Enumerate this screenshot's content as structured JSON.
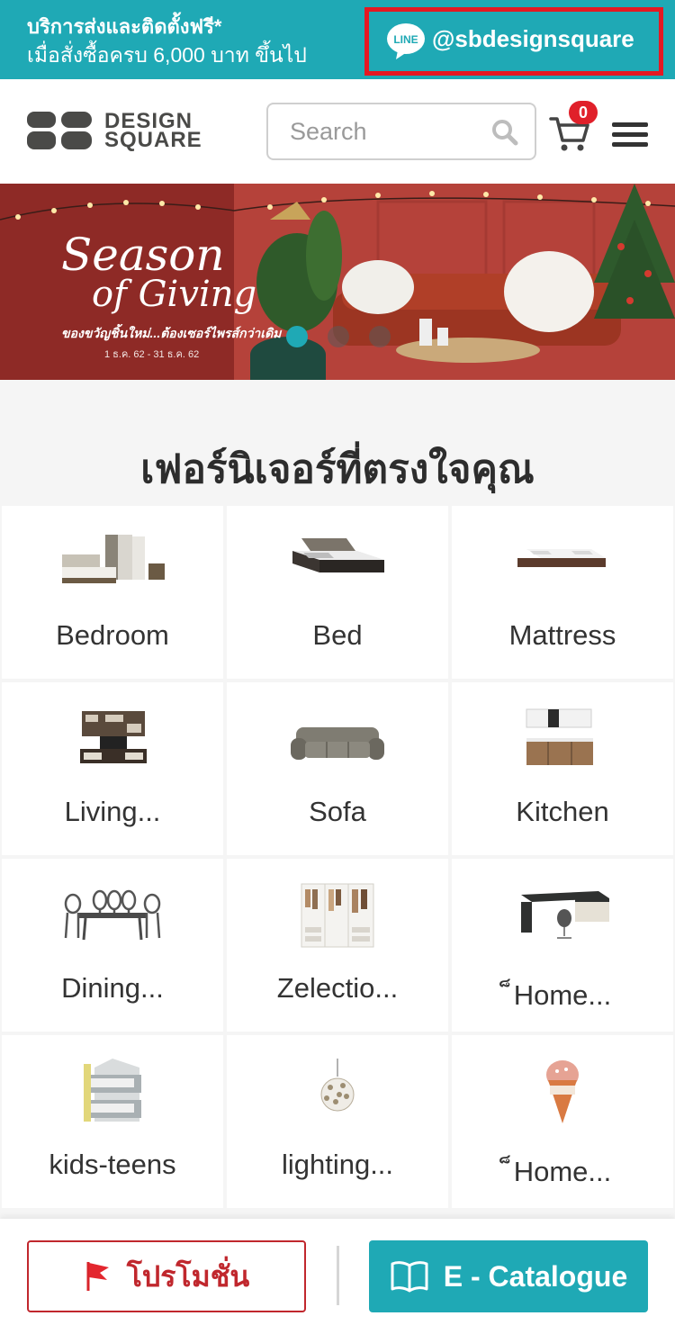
{
  "promo_bar": {
    "line1": "บริการส่งและติดตั้งฟรี*",
    "line2": "เมื่อสั่งซื้อครบ 6,000 บาท ขึ้นไป",
    "line_logo_text": "LINE",
    "line_handle": "@sbdesignsquare"
  },
  "header": {
    "brand_line1": "DESIGN",
    "brand_line2": "SQUARE",
    "search_placeholder": "Search",
    "cart_count": "0"
  },
  "banner": {
    "title_line1": "Season",
    "title_line2": "of Giving",
    "subtitle": "ของขวัญชิ้นใหม่...ต้องเซอร์ไพรส์กว่าเดิม",
    "date_range": "1 ธ.ค. 62 - 31 ธ.ค. 62",
    "slide_count": 3,
    "active_slide": 1
  },
  "section": {
    "title": "เฟอร์นิเจอร์ที่ตรงใจคุณ"
  },
  "categories": [
    {
      "label": "Bedroom",
      "icon": "bedroom-set-icon"
    },
    {
      "label": "Bed",
      "icon": "bed-icon"
    },
    {
      "label": "Mattress",
      "icon": "mattress-icon"
    },
    {
      "label": "Living...",
      "icon": "living-room-shelf-icon"
    },
    {
      "label": "Sofa",
      "icon": "sofa-icon"
    },
    {
      "label": "Kitchen",
      "icon": "kitchen-cabinet-icon"
    },
    {
      "label": "Dining...",
      "icon": "dining-set-icon"
    },
    {
      "label": "Zelectio...",
      "icon": "wardrobe-icon"
    },
    {
      "label": "็Home...",
      "icon": "office-desk-icon"
    },
    {
      "label": "kids-teens",
      "icon": "bunk-bed-icon"
    },
    {
      "label": "lighting...",
      "icon": "pendant-light-icon"
    },
    {
      "label": "็Home...",
      "icon": "decor-sign-icon"
    }
  ],
  "bottom_bar": {
    "promotion_label": "โปรโมชั่น",
    "catalogue_label": "E - Catalogue"
  },
  "colors": {
    "accent": "#1fa9b5",
    "promo_red": "#c0272d",
    "badge_red": "#e0202a",
    "highlight_border": "#e51822"
  }
}
